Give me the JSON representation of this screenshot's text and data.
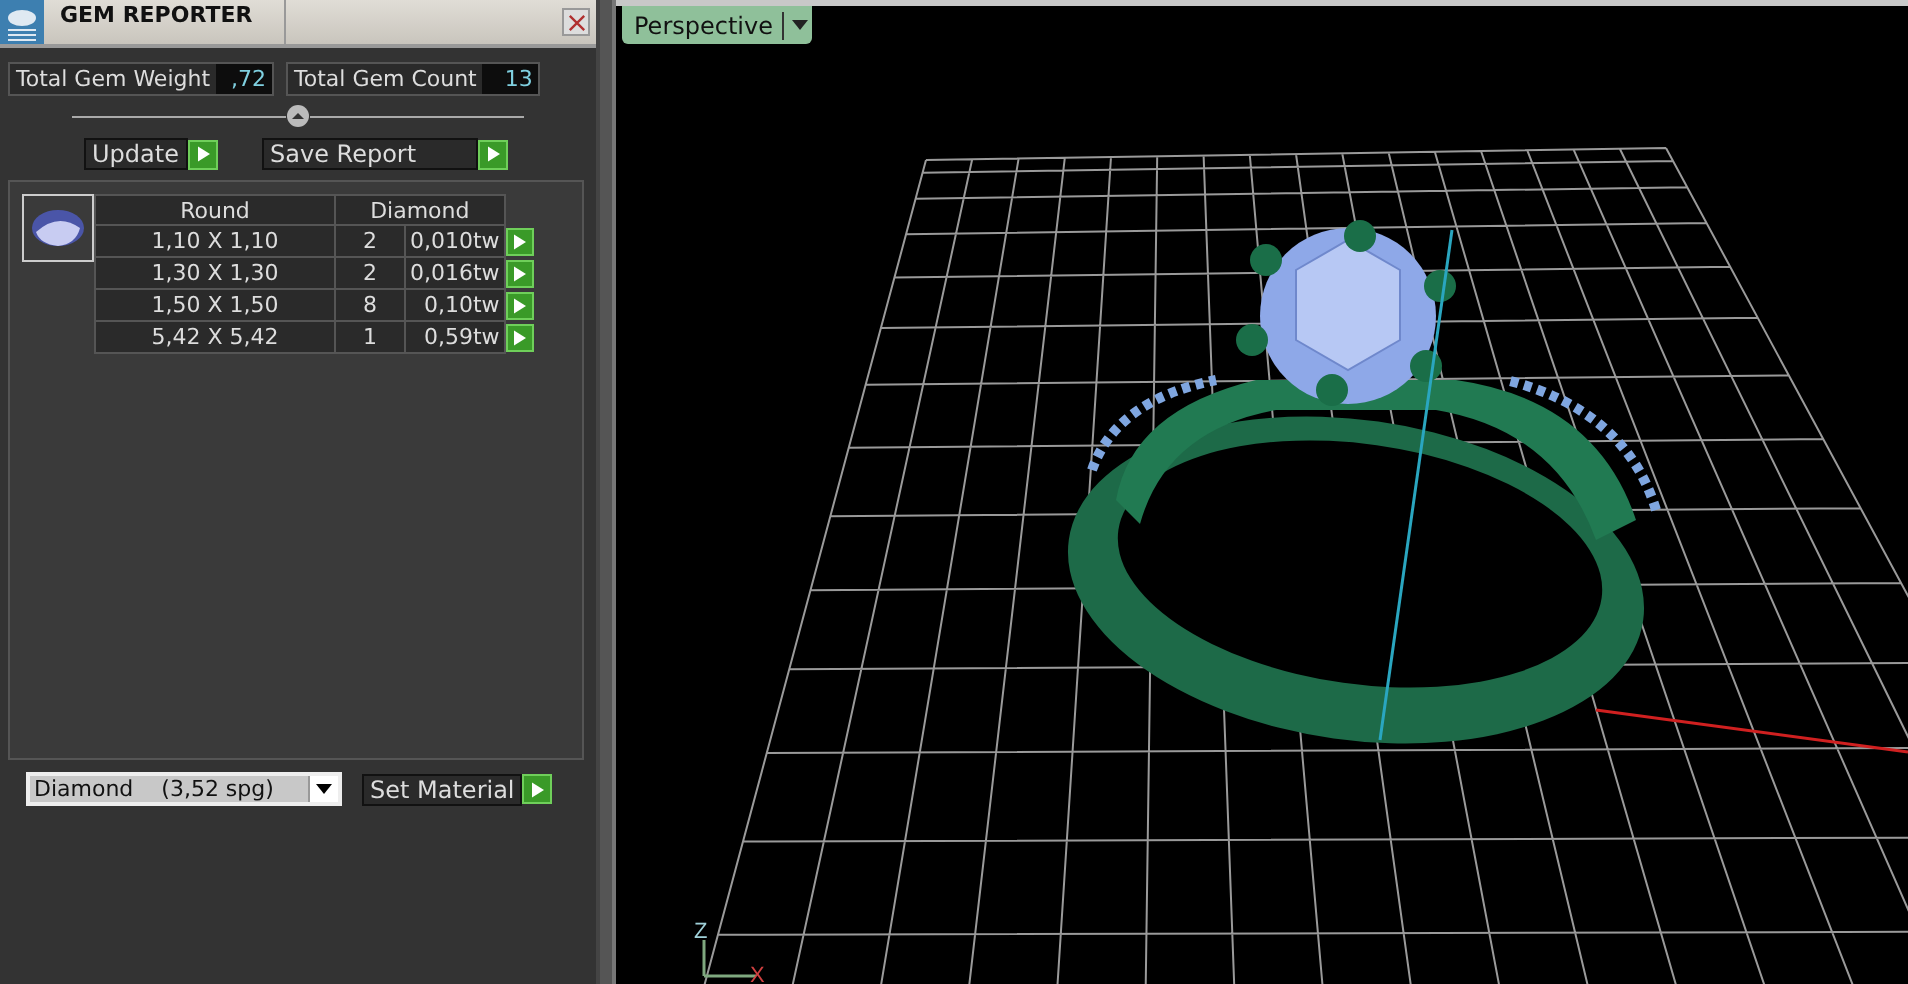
{
  "panel": {
    "title": "GEM REPORTER",
    "totals": [
      {
        "label": "Total Gem Weight",
        "value": ",72"
      },
      {
        "label": "Total Gem Count",
        "value": "13"
      }
    ],
    "buttons": [
      "Update",
      "Save Report"
    ],
    "table": {
      "columns": [
        "Round",
        "Diamond"
      ],
      "rows": [
        {
          "size": "1,10 X 1,10",
          "count": "2",
          "weight": "0,010tw"
        },
        {
          "size": "1,30 X 1,30",
          "count": "2",
          "weight": "0,016tw"
        },
        {
          "size": "1,50 X 1,50",
          "count": "8",
          "weight": "0,10tw"
        },
        {
          "size": "5,42 X 5,42",
          "count": "1",
          "weight": "0,59tw"
        }
      ]
    },
    "material": {
      "value": "Diamond    (3,52 spg)"
    },
    "set_button": "Set Material"
  },
  "viewport": {
    "view": "Perspective",
    "axes": [
      "Z",
      "X"
    ]
  }
}
